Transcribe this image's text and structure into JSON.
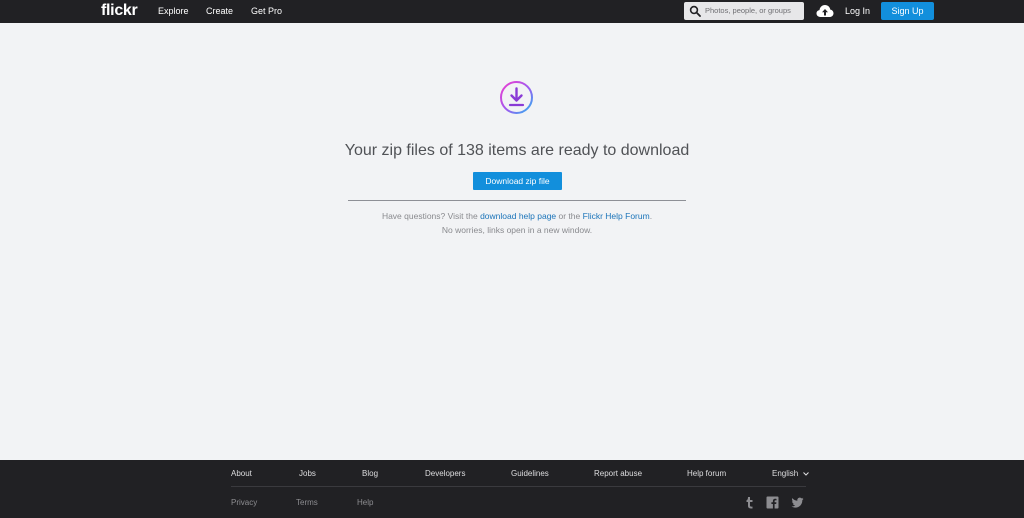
{
  "header": {
    "logo": "flickr",
    "nav": [
      "Explore",
      "Create",
      "Get Pro"
    ],
    "search_placeholder": "Photos, people, or groups",
    "login": "Log In",
    "signup": "Sign Up"
  },
  "main": {
    "headline": "Your zip files of 138 items are ready to download",
    "download_button": "Download zip file",
    "help_prefix": "Have questions? Visit the ",
    "help_link1": "download help page",
    "help_middle": " or the ",
    "help_link2": "Flickr Help Forum",
    "help_suffix": ".",
    "help_line2": "No worries, links open in a new window."
  },
  "footer": {
    "links": [
      "About",
      "Jobs",
      "Blog",
      "Developers",
      "Guidelines",
      "Report abuse",
      "Help forum"
    ],
    "language": "English",
    "legal": [
      "Privacy",
      "Terms",
      "Help"
    ],
    "social_icons": [
      "tumblr-icon",
      "facebook-icon",
      "twitter-icon"
    ]
  },
  "colors": {
    "topbar": "#212124",
    "accent": "#128fdc",
    "page_bg": "#f2f3f5",
    "link": "#1b74b9"
  }
}
